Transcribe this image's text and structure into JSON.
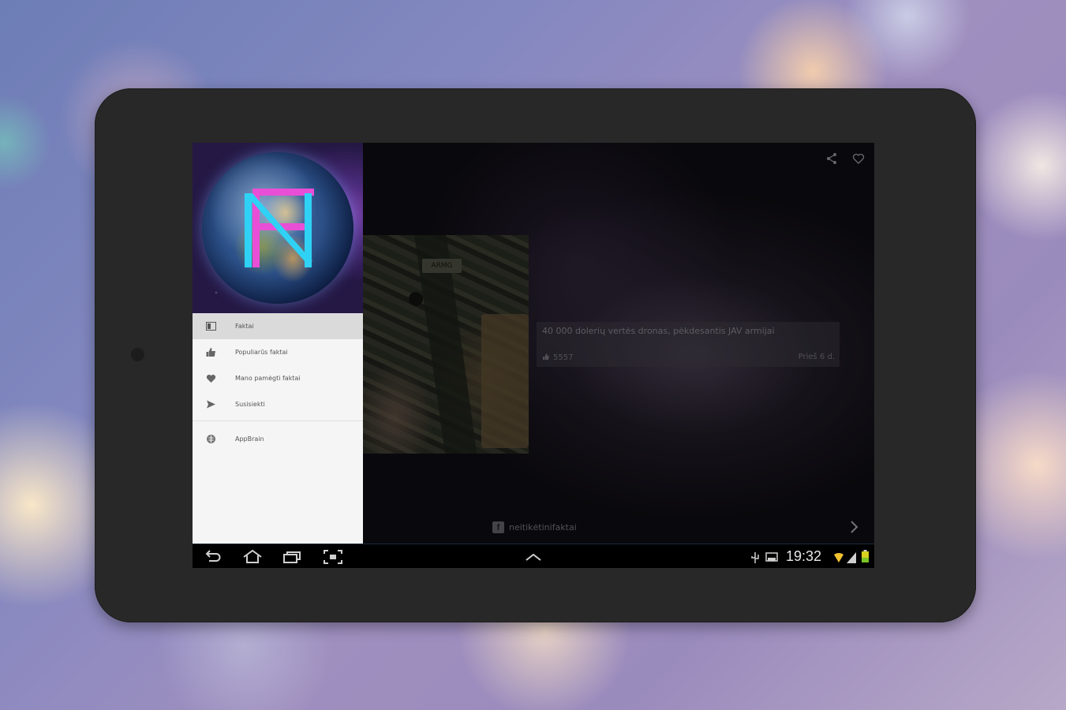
{
  "drawer": {
    "items": [
      {
        "label": "Faktai",
        "icon": "article-icon",
        "active": true
      },
      {
        "label": "Populiarūs faktai",
        "icon": "thumbs-up-icon",
        "active": false
      },
      {
        "label": "Mano pamėgti faktai",
        "icon": "heart-icon",
        "active": false
      },
      {
        "label": "Susisiekti",
        "icon": "send-icon",
        "active": false
      }
    ],
    "extra_item": {
      "label": "AppBrain",
      "icon": "appbrain-icon"
    }
  },
  "content": {
    "card": {
      "title": "40 000 dolerių vertės dronas, pėkdesantis JAV armijai",
      "likes": "5557",
      "time": "Prieš 6 d."
    },
    "source": "neitikėtinifaktai",
    "thumb_patch_text": "ARMG"
  },
  "status_bar": {
    "time": "19:32"
  },
  "colors": {
    "accent_logo_pink": "#e84fd6",
    "accent_logo_cyan": "#2fd2f5",
    "drawer_bg": "#f5f5f5",
    "active_item_bg": "#dadada"
  }
}
